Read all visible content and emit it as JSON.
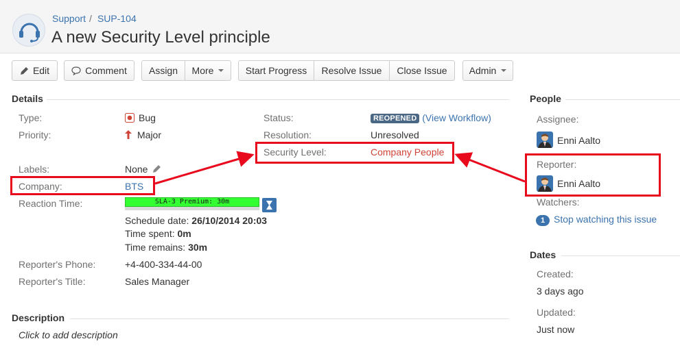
{
  "header": {
    "breadcrumb_project": "Support",
    "breadcrumb_sep": "/",
    "breadcrumb_issue": "SUP-104",
    "title": "A new Security Level principle"
  },
  "toolbar": {
    "edit": "Edit",
    "comment": "Comment",
    "assign": "Assign",
    "more": "More",
    "start_progress": "Start Progress",
    "resolve_issue": "Resolve Issue",
    "close_issue": "Close Issue",
    "admin": "Admin"
  },
  "details": {
    "title": "Details",
    "type_label": "Type:",
    "type_value": "Bug",
    "priority_label": "Priority:",
    "priority_value": "Major",
    "labels_label": "Labels:",
    "labels_value": "None",
    "company_label": "Company:",
    "company_value": "BTS",
    "reaction_label": "Reaction Time:",
    "sla_text": "SLA-3 Premium: 30m",
    "schedule_label": "Schedule date:",
    "schedule_value": "26/10/2014 20:03",
    "spent_label": "Time spent:",
    "spent_value": "0m",
    "remains_label": "Time remains:",
    "remains_value": "30m",
    "phone_label": "Reporter's Phone:",
    "phone_value": "+4-400-334-44-00",
    "reporter_title_label": "Reporter's Title:",
    "reporter_title_value": "Sales Manager",
    "status_label": "Status:",
    "status_value": "REOPENED",
    "view_workflow_open": "(",
    "view_workflow": "View Workflow",
    "view_workflow_close": ")",
    "resolution_label": "Resolution:",
    "resolution_value": "Unresolved",
    "security_label": "Security Level:",
    "security_value": "Company People"
  },
  "description": {
    "title": "Description",
    "placeholder": "Click to add description"
  },
  "people": {
    "title": "People",
    "assignee_label": "Assignee:",
    "assignee_name": "Enni Aalto",
    "reporter_label": "Reporter:",
    "reporter_name": "Enni Aalto",
    "watchers_label": "Watchers:",
    "watchers_count": "1",
    "stop_watching": "Stop watching this issue"
  },
  "dates": {
    "title": "Dates",
    "created_label": "Created:",
    "created_value": "3 days ago",
    "updated_label": "Updated:",
    "updated_value": "Just now"
  },
  "colors": {
    "link": "#3b73af",
    "security_red": "#d04437",
    "annotation_red": "#e8091c",
    "lozenge": "#4a6785",
    "sla_green": "#33ff33"
  },
  "icons": {
    "project": "headset-icon",
    "edit": "pencil-icon",
    "comment": "speech-bubble-icon",
    "type": "bug-icon",
    "priority": "arrow-up-icon",
    "labels": "pencil-icon",
    "sla": "hourglass-icon",
    "user": "user-avatar-icon"
  }
}
